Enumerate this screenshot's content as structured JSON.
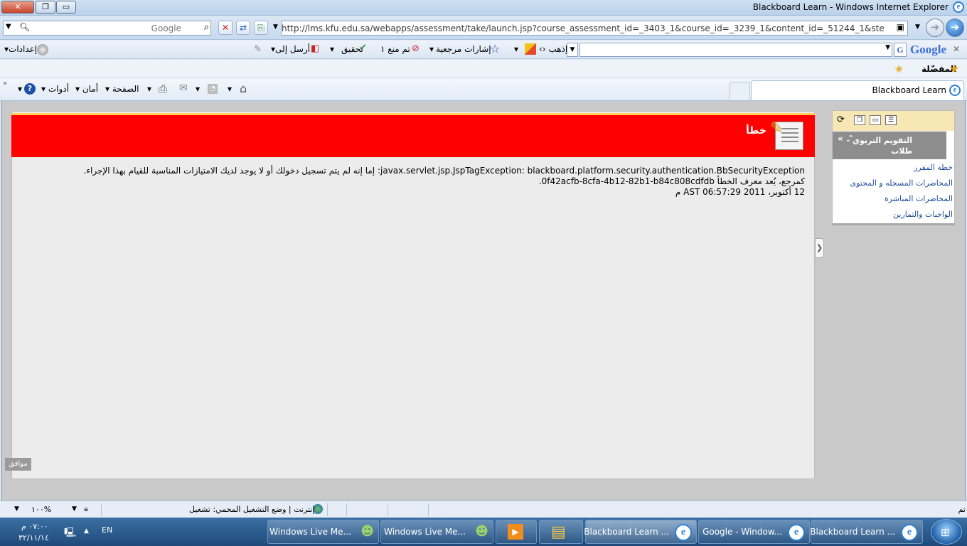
{
  "window": {
    "title": "Blackboard Learn - Windows Internet Explorer",
    "close_label": "✕",
    "max_label": "❐",
    "min_label": "▭"
  },
  "address": {
    "search_placeholder": "Google",
    "url": "http://lms.kfu.edu.sa/webapps/assessment/take/launch.jsp?course_assessment_id=_3403_1&course_id=_3239_1&content_id=_51244_1&step=null"
  },
  "google_toolbar": {
    "logo": "Google",
    "go_label": "إذهب",
    "bookmarks_label": "إشارات مرجعية",
    "popups_label": "تم منع ١",
    "check_label": "تحقيق",
    "send_label": "أرسل إلى",
    "settings_label": "إعدادات"
  },
  "favorites": {
    "label": "المفضّلة"
  },
  "tabs": [
    {
      "label": "Blackboard Learn"
    }
  ],
  "commands": {
    "page_label": "الصفحة",
    "safety_label": "أمان",
    "tools_label": "أدوات"
  },
  "error": {
    "title": "خطأ",
    "line1": "javax.servlet.jsp.JspTagException: blackboard.platform.security.authentication.BbSecurityException: إما إنه لم يتم تسجيل دخولك أو لا يوجد لديك الامتيازات المناسبة للقيام بهذا الإجراء.",
    "line2": "كمرجع، يُعد معرف الخطأ 0f42acfb-8cfa-4b12-82b1-b84c808cdfdb.",
    "line3": "12 أكتوبر، 2011 06:57:29 AST م",
    "ok_label": "موافق"
  },
  "course_menu": {
    "header": "التقويم التربوي - طلاب",
    "items": [
      "خطة المقرر",
      "المحاضرات المسجله و المحتوى",
      "المحاضرات المباشرة",
      "الواجبات والتمارين"
    ]
  },
  "status": {
    "done": "تم",
    "zone": "إنترنت | وضع التشغيل المحمي: تشغيل",
    "zoom": "١٠٠%"
  },
  "taskbar": {
    "tasks": [
      "Blackboard Learn ...",
      "Google - Window...",
      "Blackboard Learn ...",
      "Windows Live Me...",
      "Windows Live Me..."
    ],
    "lang": "EN",
    "time": "٠٧:٠٠ م",
    "date": "٣٢/١١/١٤"
  },
  "colors": {
    "error_banner": "#ff0000",
    "banner_top_border": "#ffcf5a",
    "menu_tools_bg": "#f6e7b4",
    "menu_header_bg": "#8d8d8d",
    "link": "#1f4e9b"
  }
}
